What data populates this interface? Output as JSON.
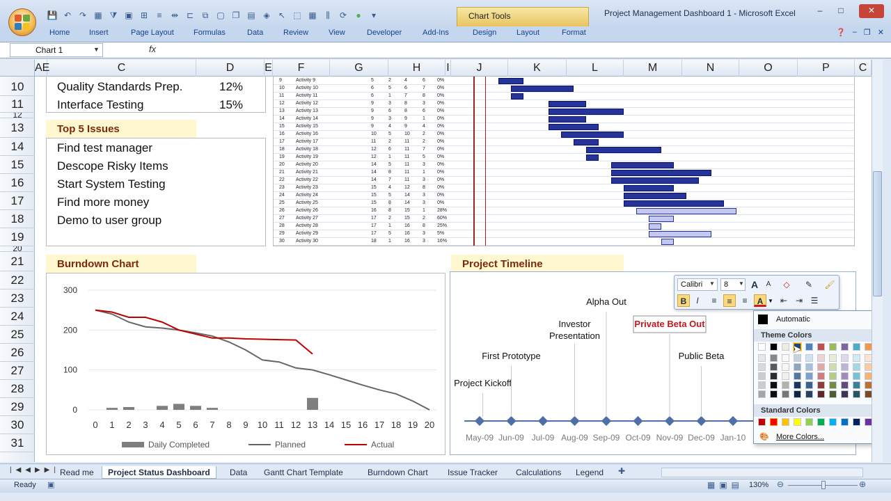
{
  "window": {
    "title": "Project Management Dashboard 1 - Microsoft Excel",
    "context_tab": "Chart Tools",
    "buttons": [
      "–",
      "□",
      "✕"
    ]
  },
  "ribbon": {
    "tabs": [
      "Home",
      "Insert",
      "Page Layout",
      "Formulas",
      "Data",
      "Review",
      "View",
      "Developer",
      "Add-Ins",
      "Design",
      "Layout",
      "Format"
    ]
  },
  "formula_bar": {
    "name_box": "Chart 1",
    "fx": "fx",
    "value": ""
  },
  "columns": [
    "AE",
    "C",
    "D",
    "E",
    "F",
    "G",
    "H",
    "I",
    "J",
    "K",
    "L",
    "M",
    "N",
    "O",
    "P",
    "C"
  ],
  "rows": [
    "10",
    "11",
    "12",
    "13",
    "14",
    "15",
    "16",
    "17",
    "18",
    "19",
    "20",
    "21",
    "22",
    "23",
    "24",
    "25",
    "26",
    "27",
    "28",
    "29",
    "30",
    "31"
  ],
  "tasks": [
    {
      "name": "Quality Standards Prep.",
      "pct": "12%"
    },
    {
      "name": "Interface Testing",
      "pct": "15%"
    }
  ],
  "issues": {
    "title": "Top 5 Issues",
    "items": [
      "Find test manager",
      "Descope Risky Items",
      "Start System Testing",
      "Find more money",
      "Demo to user group"
    ]
  },
  "gantt": {
    "rows": [
      {
        "id": "9",
        "name": "Activity 9",
        "a": "5",
        "b": "2",
        "c": "4",
        "d": "6",
        "p": "0%",
        "start": 5,
        "len": 2,
        "hatch": false
      },
      {
        "id": "10",
        "name": "Activity 10",
        "a": "6",
        "b": "5",
        "c": "6",
        "d": "7",
        "p": "0%",
        "start": 6,
        "len": 5,
        "hatch": false
      },
      {
        "id": "11",
        "name": "Activity 11",
        "a": "6",
        "b": "1",
        "c": "7",
        "d": "8",
        "p": "0%",
        "start": 6,
        "len": 1,
        "hatch": false
      },
      {
        "id": "12",
        "name": "Activity 12",
        "a": "9",
        "b": "3",
        "c": "8",
        "d": "3",
        "p": "0%",
        "start": 9,
        "len": 3,
        "hatch": false
      },
      {
        "id": "13",
        "name": "Activity 13",
        "a": "9",
        "b": "6",
        "c": "8",
        "d": "6",
        "p": "0%",
        "start": 9,
        "len": 6,
        "hatch": false
      },
      {
        "id": "14",
        "name": "Activity 14",
        "a": "9",
        "b": "3",
        "c": "9",
        "d": "1",
        "p": "0%",
        "start": 9,
        "len": 3,
        "hatch": false
      },
      {
        "id": "15",
        "name": "Activity 15",
        "a": "9",
        "b": "4",
        "c": "9",
        "d": "4",
        "p": "0%",
        "start": 9,
        "len": 4,
        "hatch": false
      },
      {
        "id": "16",
        "name": "Activity 16",
        "a": "10",
        "b": "5",
        "c": "10",
        "d": "2",
        "p": "0%",
        "start": 10,
        "len": 5,
        "hatch": false
      },
      {
        "id": "17",
        "name": "Activity 17",
        "a": "11",
        "b": "2",
        "c": "11",
        "d": "2",
        "p": "0%",
        "start": 11,
        "len": 2,
        "hatch": false
      },
      {
        "id": "18",
        "name": "Activity 18",
        "a": "12",
        "b": "6",
        "c": "11",
        "d": "7",
        "p": "0%",
        "start": 12,
        "len": 6,
        "hatch": false
      },
      {
        "id": "19",
        "name": "Activity 19",
        "a": "12",
        "b": "1",
        "c": "11",
        "d": "5",
        "p": "0%",
        "start": 12,
        "len": 1,
        "hatch": false
      },
      {
        "id": "20",
        "name": "Activity 20",
        "a": "14",
        "b": "5",
        "c": "11",
        "d": "3",
        "p": "0%",
        "start": 14,
        "len": 5,
        "hatch": false
      },
      {
        "id": "21",
        "name": "Activity 21",
        "a": "14",
        "b": "8",
        "c": "11",
        "d": "1",
        "p": "0%",
        "start": 14,
        "len": 8,
        "hatch": false
      },
      {
        "id": "22",
        "name": "Activity 22",
        "a": "14",
        "b": "7",
        "c": "11",
        "d": "3",
        "p": "0%",
        "start": 14,
        "len": 7,
        "hatch": false
      },
      {
        "id": "23",
        "name": "Activity 23",
        "a": "15",
        "b": "4",
        "c": "12",
        "d": "8",
        "p": "0%",
        "start": 15,
        "len": 4,
        "hatch": false
      },
      {
        "id": "24",
        "name": "Activity 24",
        "a": "15",
        "b": "5",
        "c": "14",
        "d": "3",
        "p": "0%",
        "start": 15,
        "len": 5,
        "hatch": false
      },
      {
        "id": "25",
        "name": "Activity 25",
        "a": "15",
        "b": "8",
        "c": "14",
        "d": "3",
        "p": "0%",
        "start": 15,
        "len": 8,
        "hatch": false
      },
      {
        "id": "26",
        "name": "Activity 26",
        "a": "16",
        "b": "8",
        "c": "15",
        "d": "1",
        "p": "28%",
        "start": 16,
        "len": 8,
        "hatch": true
      },
      {
        "id": "27",
        "name": "Activity 27",
        "a": "17",
        "b": "2",
        "c": "15",
        "d": "2",
        "p": "60%",
        "start": 17,
        "len": 2,
        "hatch": true
      },
      {
        "id": "28",
        "name": "Activity 28",
        "a": "17",
        "b": "1",
        "c": "16",
        "d": "8",
        "p": "25%",
        "start": 17,
        "len": 1,
        "hatch": true
      },
      {
        "id": "29",
        "name": "Activity 29",
        "a": "17",
        "b": "5",
        "c": "16",
        "d": "3",
        "p": "5%",
        "start": 17,
        "len": 5,
        "hatch": true
      },
      {
        "id": "30",
        "name": "Activity 30",
        "a": "18",
        "b": "1",
        "c": "16",
        "d": "3",
        "p": "16%",
        "start": 18,
        "len": 1,
        "hatch": true
      }
    ]
  },
  "burndown": {
    "title": "Burndown Chart",
    "legend": [
      "Daily Completed",
      "Planned",
      "Actual"
    ],
    "colors": {
      "daily": "#7f7f7f",
      "planned": "#666666",
      "actual": "#c00000"
    }
  },
  "chart_data": {
    "type": "line",
    "x": [
      0,
      1,
      2,
      3,
      4,
      5,
      6,
      7,
      8,
      9,
      10,
      11,
      12,
      13,
      14,
      15,
      16,
      17,
      18,
      19,
      20
    ],
    "xlim": [
      0,
      20
    ],
    "ylim": [
      0,
      300
    ],
    "yticks": [
      0,
      100,
      200,
      300
    ],
    "series": [
      {
        "name": "Planned",
        "kind": "line",
        "values": [
          250,
          240,
          220,
          208,
          205,
          200,
          193,
          185,
          170,
          150,
          125,
          120,
          105,
          100,
          88,
          75,
          62,
          50,
          40,
          22,
          0
        ]
      },
      {
        "name": "Actual",
        "kind": "line",
        "values": [
          250,
          245,
          232,
          232,
          220,
          200,
          190,
          180,
          180,
          178,
          177,
          176,
          175,
          140
        ]
      },
      {
        "name": "Daily Completed",
        "kind": "bar",
        "values": [
          0,
          5,
          7,
          0,
          10,
          15,
          10,
          5,
          0,
          0,
          0,
          0,
          0,
          30
        ]
      }
    ]
  },
  "timeline": {
    "title": "Project Timeline",
    "months": [
      "May-09",
      "Jun-09",
      "Jul-09",
      "Aug-09",
      "Sep-09",
      "Oct-09",
      "Nov-09",
      "Dec-09",
      "Jan-10",
      "F"
    ],
    "milestones": [
      {
        "label": "Project Kickoff",
        "month_index": 0.1,
        "level": 1
      },
      {
        "label": "First Prototype",
        "month_index": 1,
        "level": 2
      },
      {
        "label": "Investor\nPresentation",
        "month_index": 3,
        "level": 3
      },
      {
        "label": "Alpha Out",
        "month_index": 4,
        "level": 4
      },
      {
        "label": "Private Beta Out",
        "month_index": 6,
        "level": 3,
        "selected": true
      },
      {
        "label": "Public Beta",
        "month_index": 7,
        "level": 2
      },
      {
        "label": "R",
        "month_index": 9,
        "level": 1
      }
    ],
    "colors": {
      "axis": "#4f6fa8",
      "selected_text": "#c0181c"
    }
  },
  "mini_toolbar": {
    "font": "Calibri",
    "size": "8",
    "buttons": {
      "bold": "B",
      "italic": "I",
      "grow": "A",
      "shrink": "A"
    }
  },
  "color_picker": {
    "automatic": "Automatic",
    "theme_title": "Theme Colors",
    "standard_title": "Standard Colors",
    "more": "More Colors...",
    "theme_colors": [
      "#ffffff",
      "#000000",
      "#eeece1",
      "#1f497d",
      "#4f81bd",
      "#c0504d",
      "#9bbb59",
      "#8064a2",
      "#4bacc6",
      "#f79646"
    ],
    "standard_colors": [
      "#c00000",
      "#ff0000",
      "#ffc000",
      "#ffff00",
      "#92d050",
      "#00b050",
      "#00b0f0",
      "#0070c0",
      "#002060",
      "#7030a0"
    ]
  },
  "sheets": {
    "tabs": [
      "Read me",
      "Project Status Dashboard",
      "Data",
      "Gantt Chart Template",
      "Burndown Chart",
      "Issue Tracker",
      "Calculations",
      "Legend"
    ],
    "active": "Project Status Dashboard"
  },
  "status": {
    "mode": "Ready",
    "zoom": "130%"
  }
}
